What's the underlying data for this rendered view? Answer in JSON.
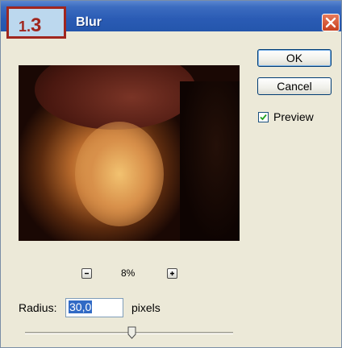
{
  "badge": {
    "prefix": "1.",
    "number": "3"
  },
  "dialog": {
    "title": "Blur"
  },
  "buttons": {
    "ok": "OK",
    "cancel": "Cancel"
  },
  "preview_toggle": {
    "label": "Preview",
    "checked": true
  },
  "zoom": {
    "value": "8%"
  },
  "radius": {
    "label": "Radius:",
    "value": "30,0",
    "unit": "pixels"
  },
  "slider": {
    "fraction": 0.5
  },
  "colors": {
    "titlebar": "#2a5bb4",
    "close": "#c8401e",
    "badge_border": "#a0261e",
    "badge_fill": "#bcd8ee",
    "selection": "#316ac5"
  },
  "icons": {
    "close": "close-icon",
    "check": "check-icon",
    "zoom_out": "minus-icon",
    "zoom_in": "plus-icon"
  }
}
